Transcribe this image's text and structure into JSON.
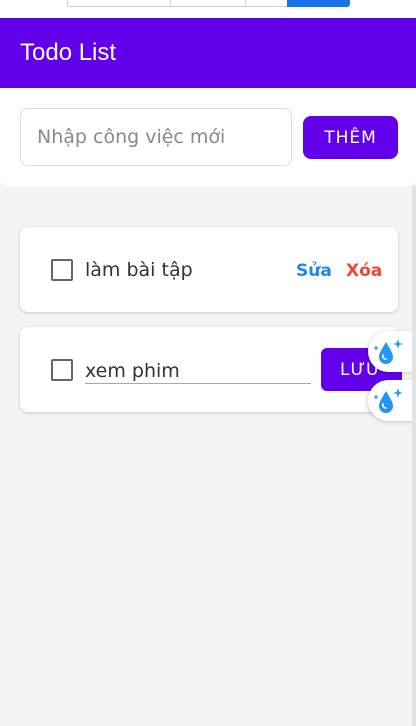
{
  "header": {
    "title": "Todo List"
  },
  "add_form": {
    "placeholder": "Nhập công việc mới",
    "add_label": "THÊM"
  },
  "todos": [
    {
      "text": "làm bài tập",
      "edit_label": "Sửa",
      "delete_label": "Xóa"
    },
    {
      "text": "xem phim",
      "save_label": "LƯU"
    }
  ],
  "colors": {
    "primary": "#6200ea",
    "edit": "#1e88e5",
    "delete": "#f44336",
    "background": "#f4f4f4"
  },
  "icons": {
    "floating": "water-sparkle-icon"
  }
}
